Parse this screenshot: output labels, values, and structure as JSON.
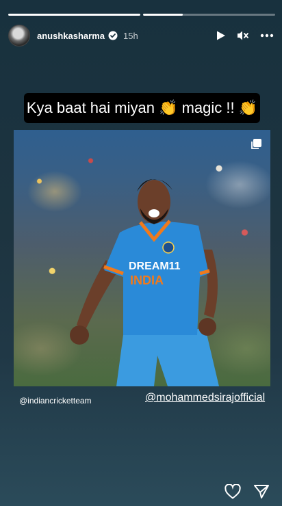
{
  "story": {
    "progress": [
      1.0,
      0.3
    ],
    "username": "anushkasharma",
    "time": "15h",
    "caption": "Kya baat hai miyan 👏 magic !! 👏",
    "tag_left": "@indiancricketteam",
    "tag_right": "@mohammedsirajofficial",
    "jersey_text_1": "DREAM11",
    "jersey_text_2": "INDIA"
  },
  "icons": {
    "verified": "verified-badge-icon",
    "play": "play-icon",
    "mute": "mute-icon",
    "more": "more-icon",
    "multi": "multiple-posts-icon",
    "like": "heart-icon",
    "share": "send-icon"
  },
  "colors": {
    "jersey_blue": "#2a8ad8",
    "jersey_orange": "#f07a1c",
    "verified_blue": "#3897f0"
  }
}
